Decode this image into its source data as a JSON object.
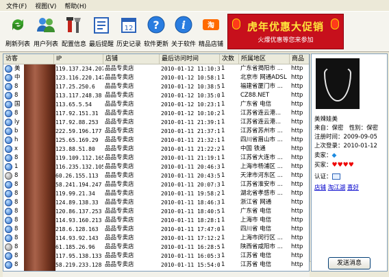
{
  "menu": [
    "文件(F)",
    "视图(V)",
    "帮助(H)"
  ],
  "toolbar": [
    {
      "label": "刷新列表",
      "icon": "refresh-icon"
    },
    {
      "label": "用户列表",
      "icon": "users-icon"
    },
    {
      "label": "配置信息",
      "icon": "tools-icon"
    },
    {
      "label": "最后提醒",
      "icon": "reminder-icon"
    },
    {
      "label": "历史记录",
      "icon": "history-icon"
    },
    {
      "label": "软件更新",
      "icon": "help-icon"
    },
    {
      "label": "关于软件",
      "icon": "info-icon"
    },
    {
      "label": "精品店铺",
      "icon": "taobao-icon"
    }
  ],
  "banner": {
    "title": "虎年优惠大促销",
    "subtitle": "火爆优惠等您来参加",
    "color": "#c7101c"
  },
  "columns": [
    "访客",
    "IP",
    "店铺",
    "最后访问时间",
    "次数",
    "所属地区",
    "商品"
  ],
  "rows": [
    {
      "ip": "119.137.234.207",
      "shop": "品品专卖店",
      "time": "2010-01-12 11:10:30",
      "count": "1",
      "region": "广东省揭阳市 ...",
      "url": "http",
      "prefix": "美",
      "gray": false
    },
    {
      "ip": "123.116.220.147",
      "shop": "品品专卖店",
      "time": "2010-01-12 10:58:11",
      "count": "1",
      "region": "北京市 网通ADSL",
      "url": "http",
      "prefix": "中",
      "gray": false
    },
    {
      "ip": "117.25.250.6",
      "shop": "品品专卖店",
      "time": "2010-01-12 10:38:50",
      "count": "1",
      "region": "福建省厦门市 ...",
      "url": "http",
      "prefix": "8",
      "gray": false
    },
    {
      "ip": "113.117.248.38",
      "shop": "品品专卖店",
      "time": "2010-01-12 10:35:01",
      "count": "1",
      "region": "CZ88.NET",
      "url": "http",
      "prefix": "8",
      "gray": false
    },
    {
      "ip": "113.65.5.54",
      "shop": "品品专卖店",
      "time": "2010-01-12 10:23:18",
      "count": "1",
      "region": "广东省 电信",
      "url": "http",
      "prefix": "国",
      "gray": false
    },
    {
      "ip": "117.92.151.31",
      "shop": "品品专卖店",
      "time": "2010-01-12 10:10:27",
      "count": "1",
      "region": "江苏省连云港...",
      "url": "http",
      "prefix": "8",
      "gray": false
    },
    {
      "ip": "117.92.88.253",
      "shop": "品品专卖店",
      "time": "2010-01-11 21:39:10",
      "count": "1",
      "region": "江苏省连云港...",
      "url": "http",
      "prefix": "ly",
      "gray": false
    },
    {
      "ip": "222.59.196.177",
      "shop": "品品专卖店",
      "time": "2010-01-11 21:37:16",
      "count": "1",
      "region": "江苏省苏州市 ...",
      "url": "http",
      "prefix": "b",
      "gray": false
    },
    {
      "ip": "125.65.169.29",
      "shop": "品品专卖店",
      "time": "2010-01-11 21:32:10",
      "count": "1",
      "region": "四川省眉山市 ...",
      "url": "http",
      "prefix": "h",
      "gray": false
    },
    {
      "ip": "123.88.51.80",
      "shop": "品品专卖店",
      "time": "2010-01-11 21:22:24",
      "count": "1",
      "region": "中国 铁通",
      "url": "http",
      "prefix": "x",
      "gray": false
    },
    {
      "ip": "119.109.112.165",
      "shop": "品品专卖店",
      "time": "2010-01-11 21:19:10",
      "count": "1",
      "region": "江苏省大连市 ...",
      "url": "http",
      "prefix": "8",
      "gray": false
    },
    {
      "ip": "116.235.132.105",
      "shop": "品品专卖店",
      "time": "2010-01-11 20:46:32",
      "count": "1",
      "region": "上海市杨浦区 ...",
      "url": "http",
      "prefix": "1",
      "gray": false
    },
    {
      "ip": "60.26.155.113",
      "shop": "品品专卖店",
      "time": "2010-01-11 20:43:56",
      "count": "1",
      "region": "天津市河东区 ...",
      "url": "http",
      "prefix": "8",
      "gray": true
    },
    {
      "ip": "58.241.194.247",
      "shop": "品品专卖店",
      "time": "2010-01-11 20:07:38",
      "count": "1",
      "region": "江苏省淮安市 ...",
      "url": "http",
      "prefix": "8",
      "gray": false
    },
    {
      "ip": "119.99.21.34",
      "shop": "品品专卖店",
      "time": "2010-01-11 19:58:23",
      "count": "1",
      "region": "湖北省孝感市 ...",
      "url": "http",
      "prefix": "8",
      "gray": false
    },
    {
      "ip": "124.89.138.33",
      "shop": "品品专卖店",
      "time": "2010-01-11 18:46:34",
      "count": "1",
      "region": "浙江省 网通",
      "url": "http",
      "prefix": "8",
      "gray": false
    },
    {
      "ip": "120.86.137.253",
      "shop": "品品专卖店",
      "time": "2010-01-11 18:40:59",
      "count": "1",
      "region": "广东省 电信",
      "url": "http",
      "prefix": "8",
      "gray": false
    },
    {
      "ip": "114.93.160.213",
      "shop": "品品专卖店",
      "time": "2010-01-11 18:28:16",
      "count": "1",
      "region": "上海市 电信",
      "url": "http",
      "prefix": "8",
      "gray": false
    },
    {
      "ip": "218.6.128.163",
      "shop": "品品专卖店",
      "time": "2010-01-11 17:47:07",
      "count": "1",
      "region": "四川省 电信",
      "url": "http",
      "prefix": "8",
      "gray": false
    },
    {
      "ip": "114.93.92.143",
      "shop": "品品专卖店",
      "time": "2010-01-11 17:12:28",
      "count": "1",
      "region": "上海市闵行区 ...",
      "url": "http",
      "prefix": "8",
      "gray": false
    },
    {
      "ip": "61.185.26.96",
      "shop": "品品专卖店",
      "time": "2010-01-11 16:28:54",
      "count": "1",
      "region": "陕西省咸阳市 ...",
      "url": "http",
      "prefix": "8",
      "gray": true
    },
    {
      "ip": "117.95.138.133",
      "shop": "品品专卖店",
      "time": "2010-01-11 16:05:34",
      "count": "1",
      "region": "江苏省 电信",
      "url": "http",
      "prefix": "8",
      "gray": false
    },
    {
      "ip": "58.219.233.128",
      "shop": "品品专卖店",
      "time": "2010-01-11 15:54:06",
      "count": "1",
      "region": "江苏省 电信",
      "url": "http",
      "prefix": "8",
      "gray": false
    }
  ],
  "profile": {
    "name": "美辣娃美",
    "from_label": "来自：",
    "from": "保密",
    "gender_label": "性别：",
    "gender": "保密",
    "reg_label": "注册时间：",
    "reg": "2009-09-05",
    "last_label": "上次登录：",
    "last": "2010-01-12",
    "seller_label": "卖家：",
    "buyer_label": "买家：",
    "cert_label": "认证：",
    "links": [
      "店铺",
      "淘江湖",
      "喜好"
    ],
    "send_label": "发送消息"
  }
}
